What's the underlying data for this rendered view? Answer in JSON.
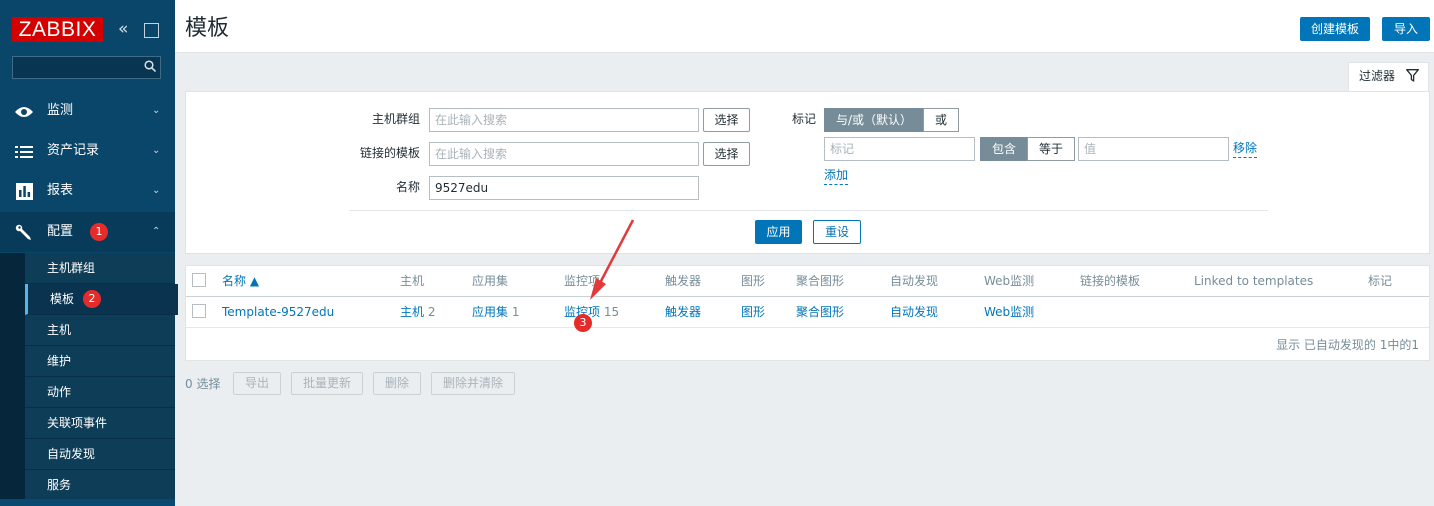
{
  "sidebar": {
    "logo": "ZABBIX",
    "collapse_icon": "«",
    "menu": [
      {
        "label": "监测",
        "icon": "eye-icon",
        "arrow": "⌄"
      },
      {
        "label": "资产记录",
        "icon": "list-icon",
        "arrow": "⌄"
      },
      {
        "label": "报表",
        "icon": "bar-chart-icon",
        "arrow": "⌄"
      },
      {
        "label": "配置",
        "icon": "wrench-icon",
        "arrow": "⌃",
        "badge": "1"
      }
    ],
    "submenu": [
      {
        "label": "主机群组"
      },
      {
        "label": "模板",
        "badge": "2"
      },
      {
        "label": "主机"
      },
      {
        "label": "维护"
      },
      {
        "label": "动作"
      },
      {
        "label": "关联项事件"
      },
      {
        "label": "自动发现"
      },
      {
        "label": "服务"
      }
    ]
  },
  "header": {
    "title": "模板",
    "create_button": "创建模板",
    "import_button": "导入"
  },
  "filter": {
    "tab_label": "过滤器",
    "host_group_label": "主机群组",
    "host_group_placeholder": "在此输入搜索",
    "linked_templates_label": "链接的模板",
    "linked_templates_placeholder": "在此输入搜索",
    "name_label": "名称",
    "name_value": "9527edu",
    "select_button": "选择",
    "tags_label": "标记",
    "andor_option": "与/或（默认）",
    "or_option": "或",
    "tag_placeholder": "标记",
    "contains_option": "包含",
    "equals_option": "等于",
    "value_placeholder": "值",
    "remove_link": "移除",
    "add_link": "添加",
    "apply_button": "应用",
    "reset_button": "重设"
  },
  "table": {
    "headers": [
      "名称 ▲",
      "主机",
      "应用集",
      "监控项",
      "触发器",
      "图形",
      "聚合图形",
      "自动发现",
      "Web监测",
      "链接的模板",
      "Linked to templates",
      "标记"
    ],
    "rows": [
      {
        "name": "Template-9527edu",
        "hosts_label": "主机",
        "hosts_count": "2",
        "apps_label": "应用集",
        "apps_count": "1",
        "items_label": "监控项",
        "items_count": "15",
        "triggers_label": "触发器",
        "graphs_label": "图形",
        "screens_label": "聚合图形",
        "discovery_label": "自动发现",
        "web_label": "Web监测"
      }
    ],
    "paging": "显示 已自动发现的 1中的1"
  },
  "actions": {
    "selected_count": "0 选择",
    "export": "导出",
    "mass_update": "批量更新",
    "delete": "删除",
    "delete_clear": "删除并清除"
  },
  "annotation": {
    "step3_badge": "3"
  },
  "colors": {
    "sidebar": "#0a466a",
    "accent": "#0275b8",
    "logo_red": "#d40000",
    "badge_red": "#e62b2b",
    "annotation_red": "#e03a3a"
  }
}
